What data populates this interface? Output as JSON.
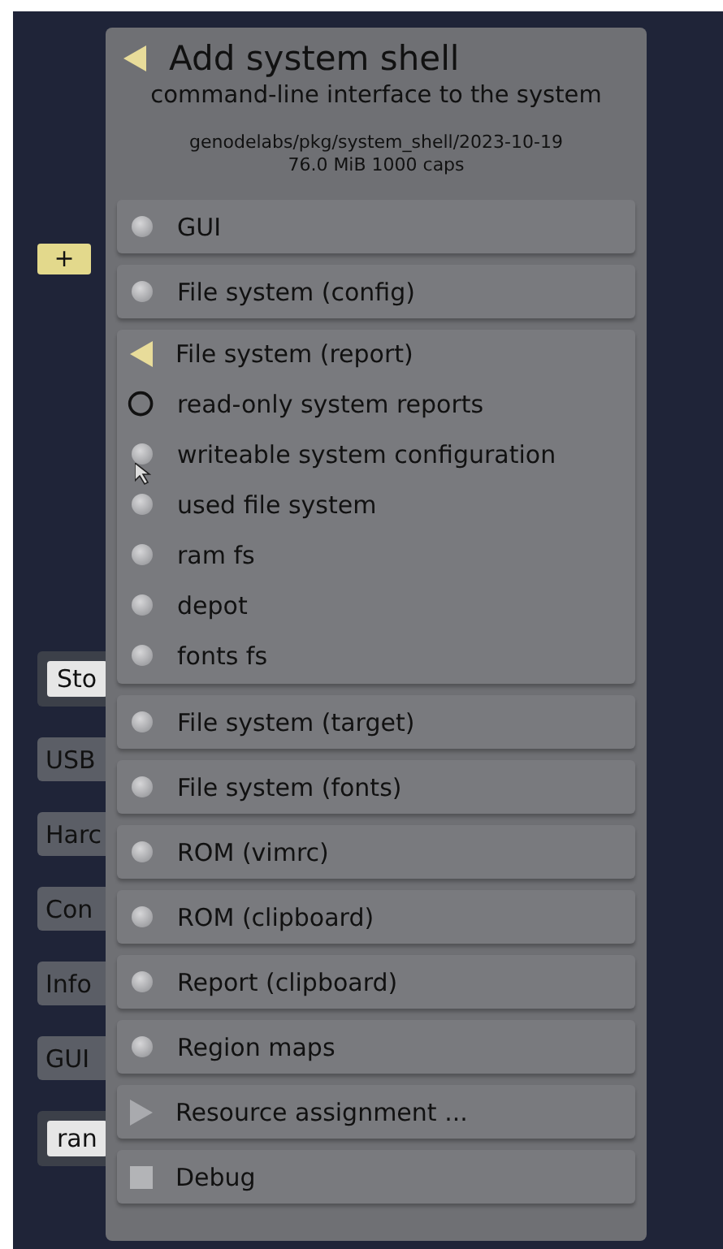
{
  "background_buttons": [
    {
      "label": "+",
      "kind": "accent"
    },
    {
      "label": "Sto",
      "kind": "framed"
    },
    {
      "label": "USB",
      "kind": "plain"
    },
    {
      "label": "Harc",
      "kind": "plain"
    },
    {
      "label": "Con",
      "kind": "plain"
    },
    {
      "label": "Info",
      "kind": "plain"
    },
    {
      "label": "GUI",
      "kind": "plain"
    },
    {
      "label": "ran",
      "kind": "framed"
    }
  ],
  "dialog": {
    "title": "Add system shell",
    "subtitle": "command-line interface to the system",
    "package": "genodelabs/pkg/system_shell/2023-10-19",
    "resources": "76.0 MiB 1000 caps",
    "sections": [
      {
        "label": "GUI",
        "kind": "radio"
      },
      {
        "label": "File system (config)",
        "kind": "radio"
      },
      {
        "label": "File system (report)",
        "kind": "group",
        "expanded": true,
        "children": [
          {
            "label": "read-only system reports",
            "hovered": true
          },
          {
            "label": "writeable system configuration",
            "hovered": false
          },
          {
            "label": "used file system",
            "hovered": false
          },
          {
            "label": "ram fs",
            "hovered": false
          },
          {
            "label": "depot",
            "hovered": false
          },
          {
            "label": "fonts fs",
            "hovered": false
          }
        ]
      },
      {
        "label": "File system (target)",
        "kind": "radio"
      },
      {
        "label": "File system (fonts)",
        "kind": "radio"
      },
      {
        "label": "ROM (vimrc)",
        "kind": "radio"
      },
      {
        "label": "ROM (clipboard)",
        "kind": "radio"
      },
      {
        "label": "Report (clipboard)",
        "kind": "radio"
      },
      {
        "label": "Region maps",
        "kind": "radio"
      },
      {
        "label": "Resource assignment ...",
        "kind": "group",
        "expanded": false
      },
      {
        "label": "Debug",
        "kind": "checkbox",
        "checked": false
      }
    ]
  }
}
